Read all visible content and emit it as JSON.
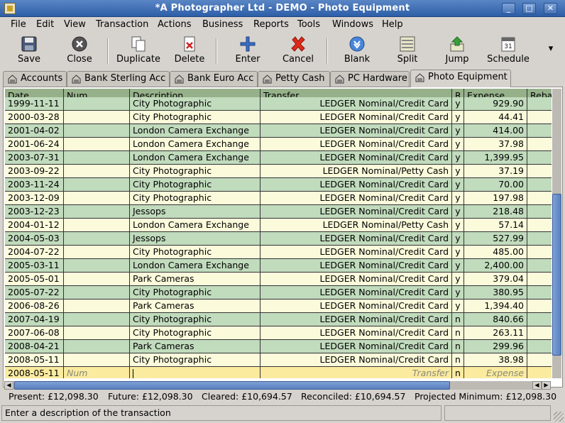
{
  "window": {
    "title": "*A Photographer Ltd - DEMO - Photo Equipment",
    "controls": [
      "_",
      "□",
      "✕"
    ]
  },
  "menu": [
    {
      "label": "File",
      "mnemonic": "F"
    },
    {
      "label": "Edit",
      "mnemonic": "E"
    },
    {
      "label": "View",
      "mnemonic": "V"
    },
    {
      "label": "Transaction",
      "mnemonic": "r"
    },
    {
      "label": "Actions",
      "mnemonic": "A"
    },
    {
      "label": "Business",
      "mnemonic": "B"
    },
    {
      "label": "Reports",
      "mnemonic": "R"
    },
    {
      "label": "Tools",
      "mnemonic": "T"
    },
    {
      "label": "Windows",
      "mnemonic": "W"
    },
    {
      "label": "Help",
      "mnemonic": "H"
    }
  ],
  "toolbar": {
    "save": "Save",
    "close": "Close",
    "duplicate": "Duplicate",
    "delete": "Delete",
    "enter": "Enter",
    "cancel": "Cancel",
    "blank": "Blank",
    "split": "Split",
    "jump": "Jump",
    "schedule": "Schedule",
    "schedule_icon_day": "31",
    "overflow": "▾"
  },
  "tabs": [
    {
      "label": "Accounts"
    },
    {
      "label": "Bank Sterling Acc"
    },
    {
      "label": "Bank Euro Acc"
    },
    {
      "label": "Petty Cash"
    },
    {
      "label": "PC Hardware"
    },
    {
      "label": "Photo Equipment",
      "active": true
    }
  ],
  "register": {
    "columns": [
      "Date",
      "Num",
      "Description",
      "Transfer",
      "R",
      "Expense",
      "Rebate"
    ],
    "rows": [
      {
        "date": "1999-11-11",
        "num": "",
        "desc": "City Photographic",
        "transfer": "LEDGER Nominal/Credit Card",
        "r": "y",
        "expense": "929.90"
      },
      {
        "date": "2000-03-28",
        "num": "",
        "desc": "City Photographic",
        "transfer": "LEDGER Nominal/Credit Card",
        "r": "y",
        "expense": "44.41"
      },
      {
        "date": "2001-04-02",
        "num": "",
        "desc": "London Camera Exchange",
        "transfer": "LEDGER Nominal/Credit Card",
        "r": "y",
        "expense": "414.00"
      },
      {
        "date": "2001-06-24",
        "num": "",
        "desc": "London Camera Exchange",
        "transfer": "LEDGER Nominal/Credit Card",
        "r": "y",
        "expense": "37.98"
      },
      {
        "date": "2003-07-31",
        "num": "",
        "desc": "London Camera Exchange",
        "transfer": "LEDGER Nominal/Credit Card",
        "r": "y",
        "expense": "1,399.95"
      },
      {
        "date": "2003-09-22",
        "num": "",
        "desc": "City Photographic",
        "transfer": "LEDGER Nominal/Petty Cash",
        "r": "y",
        "expense": "37.19"
      },
      {
        "date": "2003-11-24",
        "num": "",
        "desc": "City Photographic",
        "transfer": "LEDGER Nominal/Credit Card",
        "r": "y",
        "expense": "70.00"
      },
      {
        "date": "2003-12-09",
        "num": "",
        "desc": "City Photographic",
        "transfer": "LEDGER Nominal/Credit Card",
        "r": "y",
        "expense": "197.98"
      },
      {
        "date": "2003-12-23",
        "num": "",
        "desc": "Jessops",
        "transfer": "LEDGER Nominal/Credit Card",
        "r": "y",
        "expense": "218.48"
      },
      {
        "date": "2004-01-12",
        "num": "",
        "desc": "London Camera Exchange",
        "transfer": "LEDGER Nominal/Petty Cash",
        "r": "y",
        "expense": "57.14"
      },
      {
        "date": "2004-05-03",
        "num": "",
        "desc": "Jessops",
        "transfer": "LEDGER Nominal/Credit Card",
        "r": "y",
        "expense": "527.99"
      },
      {
        "date": "2004-07-22",
        "num": "",
        "desc": "City Photographic",
        "transfer": "LEDGER Nominal/Credit Card",
        "r": "y",
        "expense": "485.00"
      },
      {
        "date": "2005-03-11",
        "num": "",
        "desc": "London Camera Exchange",
        "transfer": "LEDGER Nominal/Credit Card",
        "r": "y",
        "expense": "2,400.00"
      },
      {
        "date": "2005-05-01",
        "num": "",
        "desc": "Park Cameras",
        "transfer": "LEDGER Nominal/Credit Card",
        "r": "y",
        "expense": "379.04"
      },
      {
        "date": "2005-07-22",
        "num": "",
        "desc": "City Photographic",
        "transfer": "LEDGER Nominal/Credit Card",
        "r": "y",
        "expense": "380.95"
      },
      {
        "date": "2006-08-26",
        "num": "",
        "desc": "Park Cameras",
        "transfer": "LEDGER Nominal/Credit Card",
        "r": "y",
        "expense": "1,394.40"
      },
      {
        "date": "2007-04-19",
        "num": "",
        "desc": "City Photographic",
        "transfer": "LEDGER Nominal/Credit Card",
        "r": "n",
        "expense": "840.66"
      },
      {
        "date": "2007-06-08",
        "num": "",
        "desc": "City Photographic",
        "transfer": "LEDGER Nominal/Credit Card",
        "r": "n",
        "expense": "263.11"
      },
      {
        "date": "2008-04-21",
        "num": "",
        "desc": "Park Cameras",
        "transfer": "LEDGER Nominal/Credit Card",
        "r": "n",
        "expense": "299.96"
      },
      {
        "date": "2008-05-11",
        "num": "",
        "desc": "City Photographic",
        "transfer": "LEDGER Nominal/Credit Card",
        "r": "n",
        "expense": "38.98"
      }
    ],
    "blank_row": {
      "date": "2008-05-11",
      "num_placeholder": "Num",
      "desc": "",
      "transfer_placeholder": "Transfer",
      "r": "n",
      "expense_placeholder": "Expense"
    }
  },
  "summary": {
    "present": "Present: £12,098.30",
    "future": "Future: £12,098.30",
    "cleared": "Cleared: £10,694.57",
    "reconciled": "Reconciled: £10,694.57",
    "projected": "Projected Minimum: £12,098.30"
  },
  "status": {
    "message": "Enter a description of the transaction"
  },
  "colors": {
    "header_bg": "#96b18a",
    "row_odd": "#fbfbdc",
    "row_even": "#c1dbbd",
    "row_blank": "#fbeb9f",
    "titlebar": "#2d5ea7"
  }
}
